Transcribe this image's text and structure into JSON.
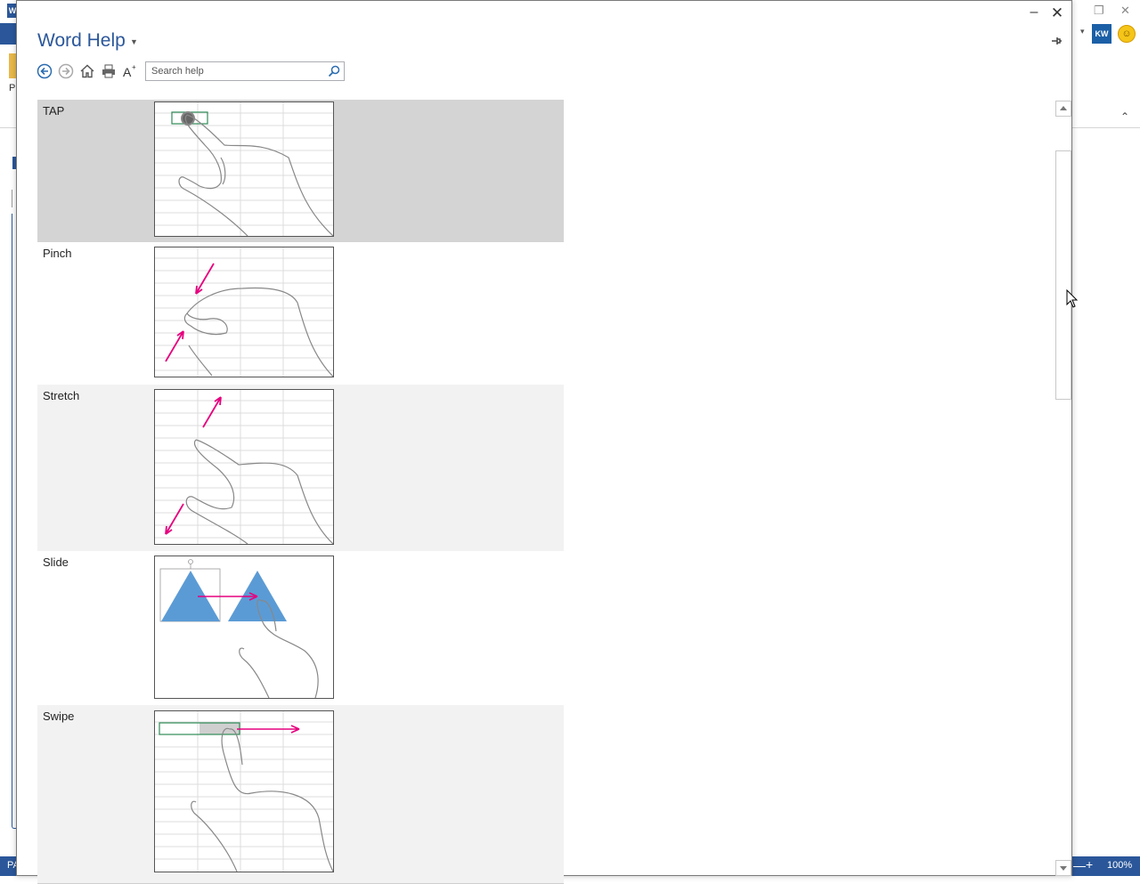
{
  "background_app": {
    "status_left": "PA",
    "zoom_level": "100%",
    "ribbon_letter": "P",
    "addin_badge": "KW",
    "accent_color": "#2b579a"
  },
  "help": {
    "title": "Word Help",
    "search": {
      "placeholder": "Search help",
      "value": ""
    },
    "toolbar": [
      "back-icon",
      "forward-icon",
      "home-icon",
      "print-icon",
      "font-size-icon"
    ],
    "gestures": [
      {
        "label": "TAP",
        "selected": true
      },
      {
        "label": "Pinch",
        "selected": false
      },
      {
        "label": "Stretch",
        "selected": false
      },
      {
        "label": "Slide",
        "selected": false
      },
      {
        "label": "Swipe",
        "selected": false
      }
    ],
    "colors": {
      "selected_row": "#d4d4d4",
      "row": "#f2f2f2",
      "arrow": "#e6007e",
      "shape": "#5b9bd5",
      "cell_highlight": "#2e8b57"
    }
  }
}
